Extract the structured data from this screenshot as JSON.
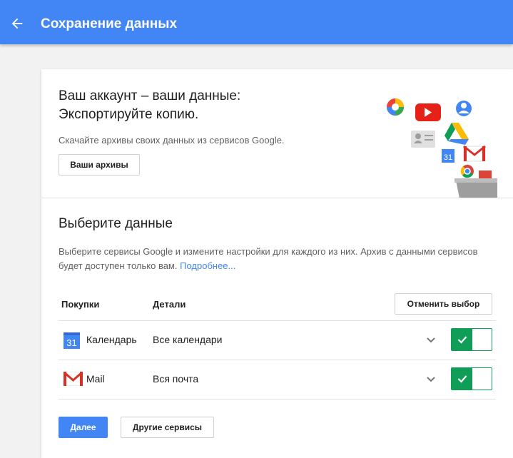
{
  "header": {
    "title": "Сохранение данных",
    "back_icon": "arrow-back-icon"
  },
  "hero": {
    "title_line1": "Ваш аккаунт – ваши данные:",
    "title_line2": "Экспортируйте копию.",
    "subtitle": "Скачайте архивы своих данных из сервисов Google.",
    "archives_button": "Ваши архивы"
  },
  "select_section": {
    "title": "Выберите данные",
    "description": "Выберите сервисы Google и измените настройки для каждого из них. Архив с данными сервисов будет доступен только вам.",
    "more_link": "Подробнее..."
  },
  "table": {
    "col_product": "Покупки",
    "col_details": "Детали",
    "deselect_button": "Отменить выбор",
    "rows": [
      {
        "icon": "calendar-icon",
        "name": "Календарь",
        "details": "Все календари",
        "enabled": true
      },
      {
        "icon": "gmail-icon",
        "name": "Mail",
        "details": "Вся почта",
        "enabled": true
      }
    ]
  },
  "actions": {
    "next_button": "Далее",
    "other_services_button": "Другие сервисы"
  },
  "colors": {
    "primary": "#4285f4",
    "toggle_on": "#0f9d58"
  }
}
